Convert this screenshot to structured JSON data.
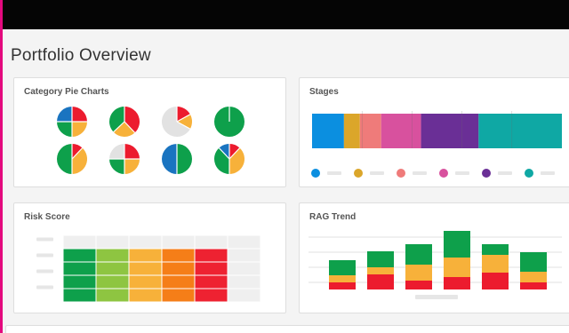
{
  "page": {
    "title": "Portfolio Overview"
  },
  "cards": {
    "pies": {
      "title": "Category Pie Charts"
    },
    "stages": {
      "title": "Stages"
    },
    "risk": {
      "title": "Risk Score"
    },
    "rag": {
      "title": "RAG Trend"
    }
  },
  "colors": {
    "green": "#0ea04b",
    "yellow": "#f7b13a",
    "red": "#ec1b2e",
    "blue": "#1a74c0",
    "gray": "#e2e2e2",
    "lime": "#8ec541",
    "orange": "#f57e18",
    "risk_red": "#ee2231",
    "placeholder": "#e6e6e6",
    "grid": "#d8d8d8"
  },
  "pie_charts": [
    [
      {
        "value": 0.25,
        "color": "#ec1b2e"
      },
      {
        "value": 0.25,
        "color": "#f7b13a"
      },
      {
        "value": 0.25,
        "color": "#0ea04b"
      },
      {
        "value": 0.25,
        "color": "#1a74c0"
      }
    ],
    [
      {
        "value": 0.38,
        "color": "#ec1b2e"
      },
      {
        "value": 0.25,
        "color": "#f7b13a"
      },
      {
        "value": 0.37,
        "color": "#0ea04b"
      }
    ],
    [
      {
        "value": 0.17,
        "color": "#ec1b2e"
      },
      {
        "value": 0.16,
        "color": "#f7b13a"
      },
      {
        "value": 0.67,
        "color": "#e2e2e2"
      }
    ],
    [
      {
        "value": 1.0,
        "color": "#0ea04b"
      }
    ],
    [
      {
        "value": 0.12,
        "color": "#ec1b2e"
      },
      {
        "value": 0.38,
        "color": "#f7b13a"
      },
      {
        "value": 0.5,
        "color": "#0ea04b"
      }
    ],
    [
      {
        "value": 0.25,
        "color": "#ec1b2e"
      },
      {
        "value": 0.25,
        "color": "#f7b13a"
      },
      {
        "value": 0.25,
        "color": "#0ea04b"
      },
      {
        "value": 0.25,
        "color": "#e2e2e2"
      }
    ],
    [
      {
        "value": 0.5,
        "color": "#0ea04b"
      },
      {
        "value": 0.5,
        "color": "#1a74c0"
      }
    ],
    [
      {
        "value": 0.12,
        "color": "#ec1b2e"
      },
      {
        "value": 0.38,
        "color": "#f7b13a"
      },
      {
        "value": 0.38,
        "color": "#0ea04b"
      },
      {
        "value": 0.12,
        "color": "#1a74c0"
      }
    ]
  ],
  "stages": [
    {
      "value": 36,
      "color": "#0b8fe0"
    },
    {
      "value": 18,
      "color": "#dba62a"
    },
    {
      "value": 24,
      "color": "#ef7b7a"
    },
    {
      "value": 45,
      "color": "#d8519e"
    },
    {
      "value": 65,
      "color": "#6a2f96"
    },
    {
      "value": 94,
      "color": "#0fa8a4"
    }
  ],
  "risk_columns": [
    "#0ea04b",
    "#8ec541",
    "#f7b13a",
    "#f57e18",
    "#ee2231"
  ],
  "risk_rows": 4,
  "rag_trend": {
    "series": [
      {
        "color": "#ec1b2e",
        "values": [
          8,
          17,
          10,
          14,
          19,
          8
        ]
      },
      {
        "color": "#f7b13a",
        "values": [
          8,
          8,
          18,
          22,
          20,
          12
        ]
      },
      {
        "color": "#0ea04b",
        "values": [
          17,
          18,
          23,
          30,
          12,
          22
        ]
      }
    ],
    "ymax": 68
  }
}
